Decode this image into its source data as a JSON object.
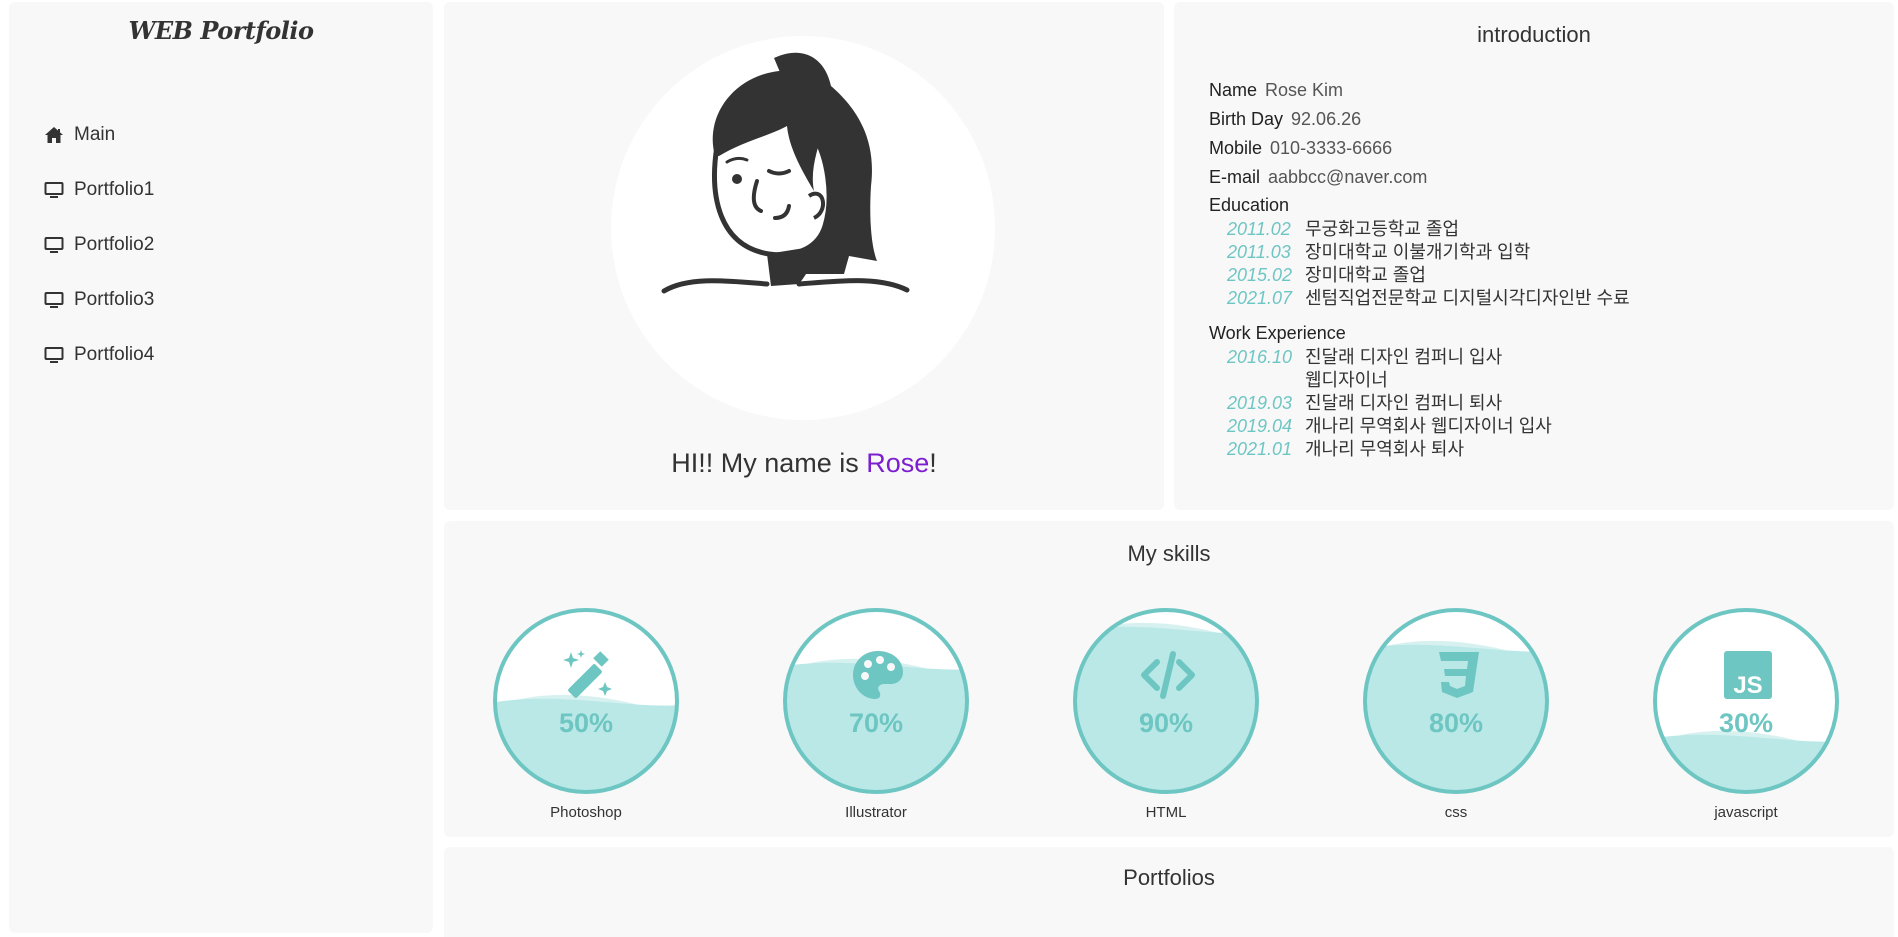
{
  "sidebar": {
    "logo": "WEB Portfolio",
    "items": [
      {
        "label": "Main",
        "icon": "home-icon"
      },
      {
        "label": "Portfolio1",
        "icon": "monitor-icon"
      },
      {
        "label": "Portfolio2",
        "icon": "monitor-icon"
      },
      {
        "label": "Portfolio3",
        "icon": "monitor-icon"
      },
      {
        "label": "Portfolio4",
        "icon": "monitor-icon"
      }
    ]
  },
  "profile": {
    "greeting_prefix": "HI!! My name is ",
    "greeting_name": "Rose",
    "greeting_suffix": "!",
    "name_color": "#7d1fd0"
  },
  "intro": {
    "title": "introduction",
    "fields": [
      {
        "label": "Name",
        "value": "Rose Kim"
      },
      {
        "label": "Birth Day",
        "value": "92.06.26"
      },
      {
        "label": "Mobile",
        "value": "010-3333-6666"
      },
      {
        "label": "E-mail",
        "value": "aabbcc@naver.com"
      }
    ],
    "education_title": "Education",
    "education": [
      {
        "date": "2011.02",
        "text": "무궁화고등학교 졸업"
      },
      {
        "date": "2011.03",
        "text": "장미대학교 이불개기학과 입학"
      },
      {
        "date": "2015.02",
        "text": "장미대학교 졸업"
      },
      {
        "date": "2021.07",
        "text": "센텀직업전문학교 디지털시각디자인반 수료"
      }
    ],
    "work_title": "Work Experience",
    "work": [
      {
        "date": "2016.10",
        "text": "진달래 디자인 컴퍼니 입사",
        "text2": "웹디자이너"
      },
      {
        "date": "2019.03",
        "text": "진달래 디자인 컴퍼니 퇴사"
      },
      {
        "date": "2019.04",
        "text": "개나리 무역회사 웹디자이너 입사"
      },
      {
        "date": "2021.01",
        "text": "개나리 무역회사 퇴사"
      }
    ]
  },
  "skills": {
    "title": "My skills",
    "accent": "#6ec6c3",
    "items": [
      {
        "label": "Photoshop",
        "percent": "50%",
        "level": 0.5,
        "icon": "magic-wand-icon"
      },
      {
        "label": "Illustrator",
        "percent": "70%",
        "level": 0.7,
        "icon": "palette-icon"
      },
      {
        "label": "HTML",
        "percent": "90%",
        "level": 0.9,
        "icon": "code-icon"
      },
      {
        "label": "css",
        "percent": "80%",
        "level": 0.8,
        "icon": "css3-icon"
      },
      {
        "label": "javascript",
        "percent": "30%",
        "level": 0.3,
        "icon": "js-icon"
      }
    ]
  },
  "portfolios": {
    "title": "Portfolios"
  }
}
